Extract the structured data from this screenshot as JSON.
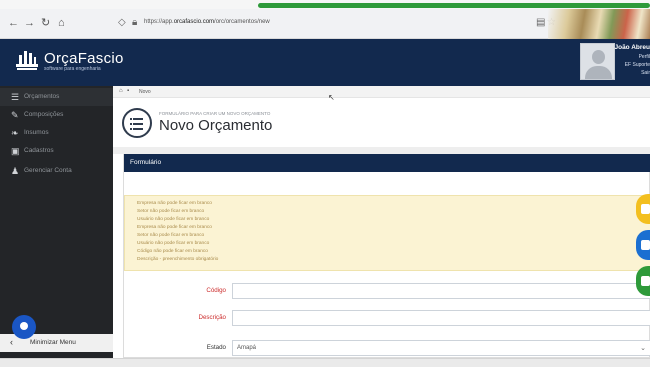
{
  "browser": {
    "url_prefix": "https://app.",
    "url_host": "orcafascio.com",
    "url_path": "/orc/orcamentos/new"
  },
  "app": {
    "brand": "OrçaFascio",
    "tagline": "software para engenharia"
  },
  "user": {
    "name": "João Abreu",
    "links": [
      "Perfil",
      "EF Suporte",
      "Sair"
    ]
  },
  "sidebar": {
    "items": [
      {
        "label": "Orçamentos",
        "icon": "list-icon"
      },
      {
        "label": "Composições",
        "icon": "pencil-icon"
      },
      {
        "label": "Insumos",
        "icon": "leaf-icon"
      },
      {
        "label": "Cadastros",
        "icon": "briefcase-icon"
      },
      {
        "label": "Gerenciar Conta",
        "icon": "user-icon"
      }
    ],
    "minimize_label": "Minimizar Menu"
  },
  "breadcrumb": {
    "current": "Novo"
  },
  "page": {
    "subtitle": "FORMULÁRIO PARA CRIAR UM NOVO ORÇAMENTO",
    "title": "Novo Orçamento"
  },
  "panel": {
    "title": "Formulário"
  },
  "alerts": [
    "Empresa não pode ficar em branco",
    "Setor não pode ficar em branco",
    "Usuário não pode ficar em branco",
    "Empresa não pode ficar em branco",
    "Setor não pode ficar em branco",
    "Usuário não pode ficar em branco",
    "Código não pode ficar em branco",
    "Descrição - preenchimento obrigatório"
  ],
  "form": {
    "codigo_label": "Código",
    "descricao_label": "Descrição",
    "estado_label": "Estado",
    "estado_value": "Amapá"
  },
  "colors": {
    "header_navy": "#12294e",
    "sidebar_dark": "#232528",
    "alert_bg": "#fbf3d3",
    "required_red": "#cc2b2b",
    "progress_green": "#2e9a3a"
  }
}
